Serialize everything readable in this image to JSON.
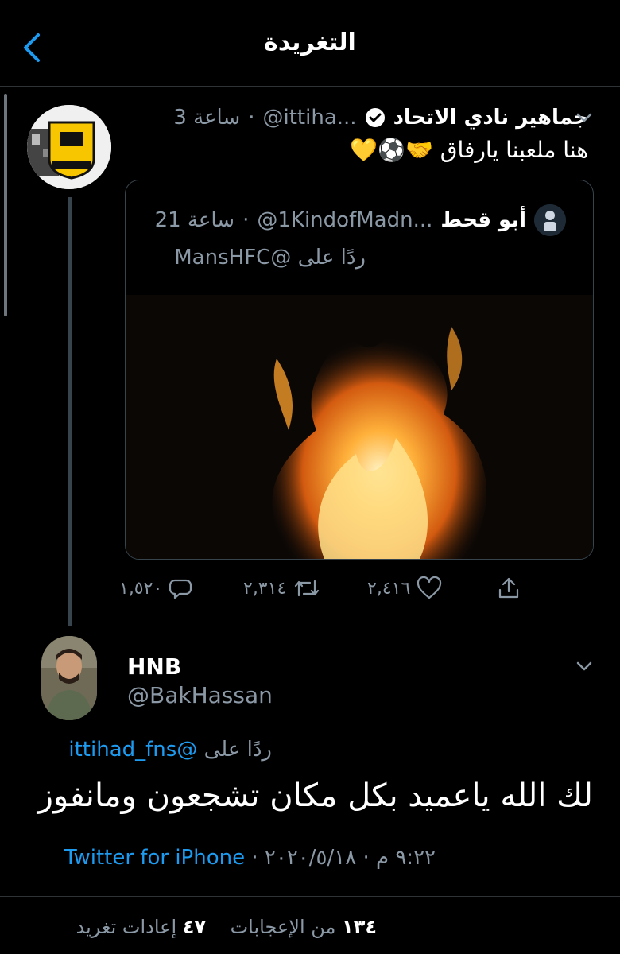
{
  "header": {
    "title": "التغريدة"
  },
  "tweet": {
    "name": "جماهير نادي الاتحاد",
    "handle": "@ittiha...",
    "time": "3 ساعة",
    "text": "هنا ملعبنا يارفاق 🤝⚽💛",
    "quote": {
      "name": "أبو قحط",
      "handle": "@1KindofMadn...",
      "time": "21 ساعة",
      "reply_prefix": "ردًا على",
      "reply_handle": "@MansHFC"
    },
    "actions": {
      "replies": "١,٥٢٠",
      "retweets": "٢,٣١٤",
      "likes": "٢,٤١٦"
    }
  },
  "reply": {
    "name": "HNB",
    "handle": "@BakHassan",
    "reply_prefix": "ردًا على",
    "reply_handle": "@ittihad_fns",
    "text": "لك الله ياعميد بكل مكان تشجعون ومانفوز",
    "time": "٩:٢٢ م",
    "date": "٢٠٢٠/٥/١٨",
    "source": "Twitter for iPhone",
    "likes_count": "١٣٤",
    "likes_label": "من الإعجابات",
    "retweets_count": "٤٧",
    "retweets_label": "إعادات تغريد"
  },
  "colors": {
    "accent": "#1d9bf0",
    "muted": "#8b98a5",
    "border": "#2f3336",
    "background": "#000000"
  }
}
